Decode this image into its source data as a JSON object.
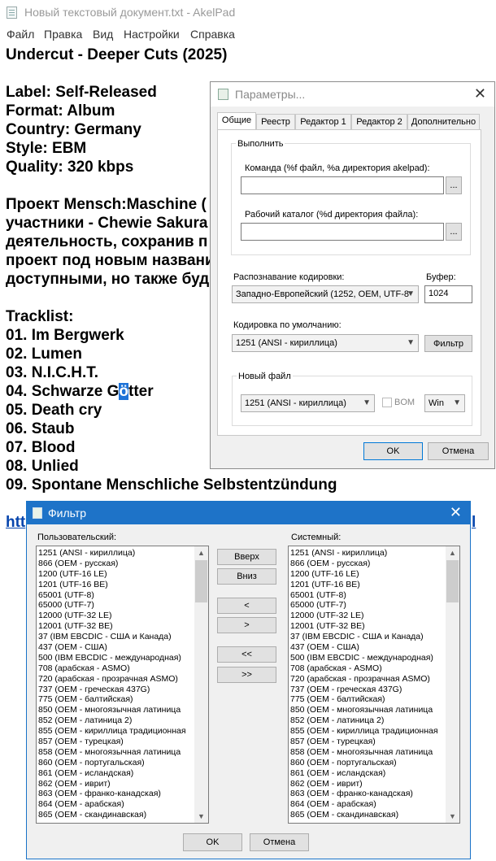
{
  "window": {
    "title": "Новый текстовый документ.txt - AkelPad",
    "menu": [
      "Файл",
      "Правка",
      "Вид",
      "Настройки",
      "Справка"
    ]
  },
  "editor": {
    "lines": [
      "Undercut - Deeper Cuts (2025)",
      "",
      "Label: Self-Released",
      "Format: Album",
      "Country: Germany",
      "Style: EBM",
      "Quality: 320 kbps",
      "",
      "Проект Mensch:Maschine (",
      "участники - Chewie Sakura",
      "деятельность, сохранив п",
      "проект под новым названи",
      "доступными, но также буд",
      "",
      "Tracklist:",
      "01. Im Bergwerk",
      "02. Lumen",
      "03. N.I.C.H.T.",
      "04. Schwarze Götter",
      "05. Death cry",
      "06. Staub",
      "07. Blood",
      "08. Unlied",
      "09. Spontane Menschliche Selbstentzündung",
      ""
    ],
    "selected_char_line": 18,
    "link_prefix": "htt",
    "link_suffix": "l",
    "track04": {
      "before": "04. Schwarze G",
      "sel": "ö",
      "after": "tter"
    }
  },
  "params_dialog": {
    "title": "Параметры...",
    "tabs": [
      "Общие",
      "Реестр",
      "Редактор 1",
      "Редактор 2",
      "Дополнительно"
    ],
    "execute_group": "Выполнить",
    "command_label": "Команда (%f файл, %a директория akelpad):",
    "command_value": "",
    "workdir_label": "Рабочий каталог (%d директория файла):",
    "workdir_value": "",
    "browse": "...",
    "encoding_detect_label": "Распознавание кодировки:",
    "encoding_detect_value": "Западно-Европейский (1252, OEM, UTF-8",
    "buffer_label": "Буфер:",
    "buffer_value": "1024",
    "default_encoding_label": "Кодировка по умолчанию:",
    "default_encoding_value": "1251  (ANSI - кириллица)",
    "filter_button": "Фильтр",
    "new_file_group": "Новый файл",
    "new_file_encoding": "1251  (ANSI - кириллица)",
    "bom_label": "BOM",
    "newline_value": "Win",
    "ok": "OK",
    "cancel": "Отмена"
  },
  "filter_dialog": {
    "title": "Фильтр",
    "user_label": "Пользовательский:",
    "system_label": "Системный:",
    "up": "Вверх",
    "down": "Вниз",
    "move_left": "<",
    "move_right": ">",
    "all_left": "<<",
    "all_right": ">>",
    "ok": "OK",
    "cancel": "Отмена",
    "user_items": [
      "1251  (ANSI - кириллица)",
      "866  (OEM - русская)",
      "1200  (UTF-16 LE)",
      "1201  (UTF-16 BE)",
      "65001 (UTF-8)",
      "65000 (UTF-7)",
      "12000  (UTF-32 LE)",
      "12001  (UTF-32 BE)",
      "37   (IBM EBCDIC - США и Канада)",
      "437  (OEM - США)",
      "500  (IBM EBCDIC - международная)",
      "708  (арабская - ASMO)",
      "720  (арабская - прозрачная ASMO)",
      "737  (OEM - греческая 437G)",
      "775  (OEM - балтийская)",
      "850  (OEM - многоязычная латиница",
      "852  (OEM - латиница 2)",
      "855  (OEM - кириллица традиционная",
      "857  (OEM - турецкая)",
      "858  (OEM - многоязычная латиница",
      "860  (OEM - португальская)",
      "861  (OEM - исландская)",
      "862  (OEM - иврит)",
      "863  (OEM - франко-канадская)",
      "864  (OEM - арабская)",
      "865  (OEM - скандинавская)"
    ],
    "system_items": [
      "1251  (ANSI - кириллица)",
      "866  (OEM - русская)",
      "1200  (UTF-16 LE)",
      "1201  (UTF-16 BE)",
      "65001 (UTF-8)",
      "65000 (UTF-7)",
      "12000  (UTF-32 LE)",
      "12001  (UTF-32 BE)",
      "37   (IBM EBCDIC - США и Канада)",
      "437  (OEM - США)",
      "500  (IBM EBCDIC - международная)",
      "708  (арабская - ASMO)",
      "720  (арабская - прозрачная ASMO)",
      "737  (OEM - греческая 437G)",
      "775  (OEM - балтийская)",
      "850  (OEM - многоязычная латиница",
      "852  (OEM - латиница 2)",
      "855  (OEM - кириллица традиционная",
      "857  (OEM - турецкая)",
      "858  (OEM - многоязычная латиница",
      "860  (OEM - португальская)",
      "861  (OEM - исландская)",
      "862  (OEM - иврит)",
      "863  (OEM - франко-канадская)",
      "864  (OEM - арабская)",
      "865  (OEM - скандинавская)"
    ]
  }
}
